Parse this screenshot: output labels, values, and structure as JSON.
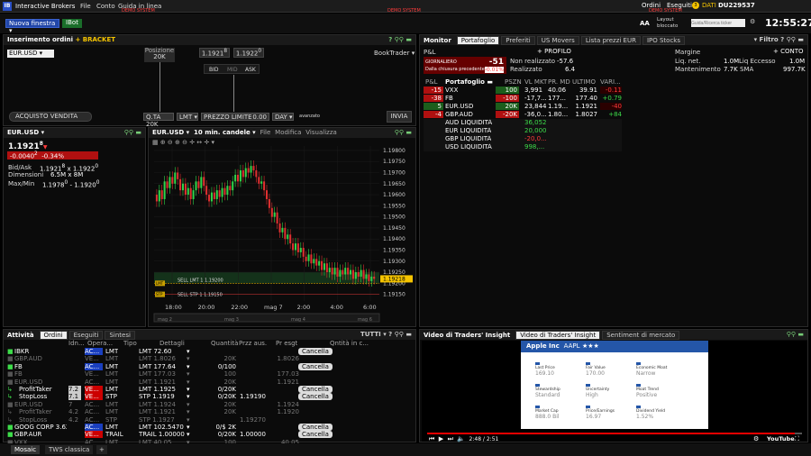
{
  "topbar": {
    "logo": "IB",
    "title": "Interactive Brokers",
    "menus": [
      "File",
      "Conto",
      "Guida in linea"
    ],
    "demo1": "DEMO SYSTEM",
    "demo2": "DEMO SYSTEM",
    "demo3": "DEMO SYSTEM",
    "orders": "Ordini",
    "executed": "Eseguiti",
    "exec_count": "3",
    "data": "DATI",
    "account": "DU229537",
    "new_window": "Nuova finestra",
    "ibot": "IBot",
    "search_placeholder": "Guida/Ricerca ticker",
    "aa": "AA",
    "layout": "Layout bloccato",
    "clock": "12:55:27"
  },
  "order_entry": {
    "title": "Inserimento ordini",
    "bracket": "BRACKET",
    "symbol": "EUR.USD",
    "position_label": "Posizione",
    "position_value": "20K",
    "bid": "1.1921",
    "bid_sup": "8",
    "ask": "1.1922",
    "ask_sup": "0",
    "booktrader": "BookTrader",
    "bid_lbl": "BID",
    "mid_lbl": "MID",
    "ask_lbl": "ASK",
    "buy": "ACQUISTO",
    "sell": "VENDITA",
    "qty_label": "Q.TA",
    "qty": "20K",
    "type": "LMT",
    "limit_label": "PREZZO LIMITE",
    "limit": "0.00",
    "tif": "DAY",
    "advanced": "avanzato",
    "send": "INVIA"
  },
  "quote": {
    "symbol": "EUR.USD",
    "price": "1.1921",
    "price_sup": "8",
    "change": "-0.0040",
    "change_sup": "2",
    "change_pct": "-0.34%",
    "bidask_lbl": "Bid/Ask",
    "bidask": "1.1921",
    "bidask_s1": "8",
    "bidask2": "x 1.1922",
    "bidask_s2": "0",
    "size_lbl": "Dimensioni",
    "size": "6.5M x 8M",
    "minmax_lbl": "Max/Min",
    "minmax": "1.1978",
    "minmax_s1": "0",
    "minmax2": "- 1.1920",
    "minmax_s2": "0"
  },
  "chart": {
    "symbol": "EUR.USD",
    "interval": "10 min. candele",
    "menus": [
      "File",
      "Modifica",
      "Visualizza"
    ],
    "yticks": [
      "1.19800",
      "1.19750",
      "1.19700",
      "1.19650",
      "1.19600",
      "1.19550",
      "1.19500",
      "1.19450",
      "1.19400",
      "1.19350",
      "1.19300",
      "1.19250",
      "1.19200",
      "1.19150"
    ],
    "xticks": [
      "18:00",
      "20:00",
      "22:00",
      "mag 7",
      "2:00",
      "4:00",
      "6:00"
    ],
    "mini": [
      "mag 2",
      "mag 3",
      "mag 4",
      "mag 6"
    ],
    "sell_lmt_label": "SELL LMT 1 1.19200",
    "sell_stp_label": "SELL STP 1 1.19150",
    "tag1": "LMT",
    "tag2": "STP",
    "last_tag": "1.19218"
  },
  "chart_data": {
    "type": "candlestick",
    "ylim": [
      1.1912,
      1.1982
    ],
    "x_labels": [
      "18:00",
      "20:00",
      "22:00",
      "mag 7",
      "2:00",
      "4:00",
      "6:00"
    ],
    "close": [
      1.1957,
      1.1962,
      1.1958,
      1.1966,
      1.1963,
      1.1968,
      1.1965,
      1.197,
      1.1967,
      1.1962,
      1.1965,
      1.196,
      1.1963,
      1.1958,
      1.1962,
      1.1966,
      1.1963,
      1.1968,
      1.1964,
      1.196,
      1.1957,
      1.1961,
      1.1958,
      1.1962,
      1.1959,
      1.1963,
      1.196,
      1.1964,
      1.1962,
      1.1966,
      1.1969,
      1.1966,
      1.1971,
      1.1968,
      1.1972,
      1.197,
      1.1973,
      1.1971,
      1.1968,
      1.1965,
      1.1966,
      1.1962,
      1.1958,
      1.1954,
      1.195,
      1.1952,
      1.1947,
      1.1943,
      1.1945,
      1.194,
      1.1942,
      1.1938,
      1.1935,
      1.1938,
      1.1934,
      1.1936,
      1.1932,
      1.193,
      1.1933,
      1.1929,
      1.1931,
      1.1928,
      1.193,
      1.1926,
      1.1929,
      1.1925,
      1.1927,
      1.1924,
      1.1927,
      1.1923,
      1.1926,
      1.1924,
      1.1927,
      1.1924,
      1.1926,
      1.1922,
      1.1925,
      1.1923,
      1.1926,
      1.1922,
      1.1924,
      1.1921,
      1.1923,
      1.1922
    ]
  },
  "monitor": {
    "title": "Monitor",
    "tabs": [
      "Portafoglio",
      "Preferiti",
      "US Movers",
      "Lista prezzi EUR",
      "IPO Stocks"
    ],
    "filter": "Filtro",
    "profilo": "+ PROFILO",
    "conto": "+ CONTO",
    "pl": "P&L",
    "daily_lbl": "GIORNALIERO",
    "daily_val": "-51",
    "since_lbl": "Dalla chiusura precedente",
    "since_val": "-0.01%",
    "unreal_lbl": "Non realizzato",
    "unreal_val": "-57.6",
    "real_lbl": "Realizzato",
    "real_val": "6.4",
    "margin_lbl": "Margine",
    "liq_lbl": "Liq. net.",
    "liq_val": "1.0M",
    "liqex_lbl": "Liq Eccesso",
    "liqex_val": "1.0M",
    "mant_lbl": "Mantenimento",
    "mant_val": "7.7K",
    "sma_lbl": "SMA",
    "sma_val": "997.7K",
    "cols": [
      "P&L",
      "Portafoglio",
      "PSZN",
      "VL MKT",
      "PR. MD",
      "ULTIMO",
      "VARI..."
    ],
    "rows": [
      {
        "pl": "-15",
        "sym": "VXX",
        "pos": "100",
        "mkt": "3,991",
        "avg": "40.06",
        "last": "39.91",
        "chg": "-0.11"
      },
      {
        "pl": "-38",
        "sym": "FB",
        "pos": "-100",
        "mkt": "-17,7...",
        "avg": "177...",
        "last": "177.40",
        "chg": "+0.79"
      },
      {
        "pl": "5",
        "sym": "EUR.USD",
        "pos": "20K",
        "mkt": "23,844",
        "avg": "1.19...",
        "last": "1.1921",
        "chg": "-40"
      },
      {
        "pl": "-4",
        "sym": "GBP.AUD",
        "pos": "-20K",
        "mkt": "-36,0...",
        "avg": "1.80...",
        "last": "1.8027",
        "chg": "+84"
      }
    ],
    "liq": [
      {
        "sym": "AUD LIQUIDITÀ",
        "mkt": "36,052"
      },
      {
        "sym": "EUR LIQUIDITÀ",
        "mkt": "20,000"
      },
      {
        "sym": "GBP LIQUIDITÀ",
        "mkt": "-20,0..."
      },
      {
        "sym": "USD LIQUIDITÀ",
        "mkt": "998,..."
      }
    ]
  },
  "activity": {
    "title": "Attività",
    "tabs": [
      "Ordini",
      "Eseguiti",
      "Sintesi"
    ],
    "all": "TUTTI",
    "cols": [
      "Idn...",
      "Opera...",
      "Tipo",
      "Dettagli",
      "Quantità",
      "Przz aus.",
      "Pr esgt",
      "Qntità in c..."
    ],
    "rows": [
      {
        "sym": "IBKR",
        "op": "AC...",
        "type": "LMT",
        "det": "LMT 72.60",
        "qty": "",
        "aux": "",
        "px": "",
        "btn": "Cancella"
      },
      {
        "sym": "GBP.AUD",
        "op": "VE...",
        "type": "LMT",
        "det": "LMT 1.8026",
        "qty": "20K",
        "aux": "",
        "px": "1.8026",
        "btn": ""
      },
      {
        "sym": "FB",
        "op": "AC...",
        "type": "LMT",
        "det": "LMT 177.64",
        "qty": "0/100",
        "aux": "",
        "px": "",
        "btn": "Cancella"
      },
      {
        "sym": "FB",
        "op": "VE...",
        "type": "LMT",
        "det": "LMT 177.03",
        "qty": "100",
        "aux": "",
        "px": "177.03",
        "btn": ""
      },
      {
        "sym": "EUR.USD",
        "op": "AC...",
        "type": "LMT",
        "det": "LMT 1.1921",
        "qty": "20K",
        "aux": "",
        "px": "1.1921",
        "btn": ""
      },
      {
        "sym": "ProfitTaker",
        "op": "VE...",
        "type": "LMT",
        "det": "LMT 1.1925",
        "qty": "0/20K",
        "aux": "",
        "px": "",
        "btn": "Cancella"
      },
      {
        "sym": "StopLoss",
        "op": "VE...",
        "type": "STP",
        "det": "STP 1.1919",
        "qty": "0/20K",
        "aux": "1.19190",
        "px": "",
        "btn": "Cancella"
      },
      {
        "sym": "EUR.USD",
        "op": "AC...",
        "type": "LMT",
        "det": "LMT 1.1924",
        "qty": "20K",
        "aux": "",
        "px": "1.1924",
        "btn": ""
      },
      {
        "sym": "ProfitTaker",
        "op": "AC...",
        "type": "LMT",
        "det": "LMT 1.1921",
        "qty": "20K",
        "aux": "",
        "px": "1.1920",
        "btn": ""
      },
      {
        "sym": "StopLoss",
        "op": "AC...",
        "type": "STP",
        "det": "STP 1.1927",
        "qty": "",
        "aux": "1.19270",
        "px": "",
        "btn": ""
      },
      {
        "sym": "GOOG CORP 3.62...",
        "op": "AC...",
        "type": "LMT",
        "det": "LMT 102.5470",
        "qty": "0/$ 2K",
        "aux": "",
        "px": "",
        "btn": "Cancella"
      },
      {
        "sym": "GBP.AUR",
        "op": "VE...",
        "type": "TRAIL",
        "det": "TRAIL 1.00000",
        "qty": "0/20K",
        "aux": "1.00000",
        "px": "",
        "btn": "Cancella"
      },
      {
        "sym": "VXX",
        "op": "AC...",
        "type": "LMT",
        "det": "LMT 40.05",
        "qty": "100",
        "aux": "",
        "px": "40.05",
        "btn": ""
      }
    ],
    "extra": [
      "7.2",
      "7.1",
      "7",
      "4.2",
      "4.2"
    ]
  },
  "video": {
    "title": "Video di Traders' Insight",
    "tabs": [
      "Video di Traders' Insight",
      "Sentiment di mercato"
    ],
    "company": "Apple Inc",
    "ticker": "AAPL",
    "stars": "★★★",
    "time": "2:48 / 2:51",
    "youtube": "YouTube",
    "metrics": [
      {
        "l": "Last Price",
        "v": "169.10"
      },
      {
        "l": "Fair Value",
        "v": "170.00"
      },
      {
        "l": "Economic Moat",
        "v": "Narrow"
      },
      {
        "l": "Stewardship",
        "v": "Standard"
      },
      {
        "l": "Uncertainty",
        "v": "High"
      },
      {
        "l": "Moat Trend",
        "v": "Positive"
      },
      {
        "l": "Market Cap",
        "v": "888.0 Bil"
      },
      {
        "l": "Price/Earnings",
        "v": "16.97"
      },
      {
        "l": "Dividend Yield",
        "v": "1.52%"
      }
    ]
  },
  "bottom": {
    "tabs": [
      "Mosaic",
      "TWS classica"
    ],
    "plus": "+"
  },
  "colors": {
    "red": "#ff3b3b",
    "green": "#3ddc4a",
    "accent": "#f5c400"
  }
}
